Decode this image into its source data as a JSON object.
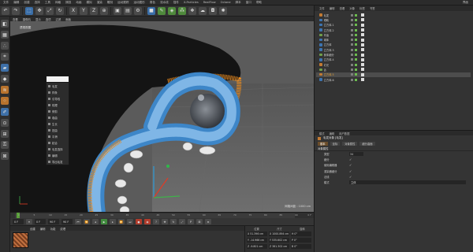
{
  "menubar": {
    "items": [
      "文件",
      "编辑",
      "创建",
      "选择",
      "工具",
      "网格",
      "捕捉",
      "动画",
      "模拟",
      "渲染",
      "雕刻",
      "运动跟踪",
      "运动图形",
      "角色",
      "流水线",
      "插件",
      "X-Particles",
      "RealFlow",
      "Octane",
      "脚本",
      "窗口",
      "帮助"
    ],
    "right_label": "界面"
  },
  "viewport": {
    "menu": [
      "查看",
      "摄像机",
      "显示",
      "选项",
      "过滤",
      "面板"
    ],
    "label": "透视视图",
    "footer": "网格间距 : 1000 cm"
  },
  "context_menu": {
    "items": [
      "毛发",
      "样条",
      "引导线",
      "梳理",
      "修剪",
      "卷曲",
      "生长",
      "扭曲",
      "平滑",
      "粘合",
      "毛发选择",
      "编辑",
      "导出毛发"
    ]
  },
  "timeline": {
    "ticks": [
      "0",
      "5",
      "10",
      "15",
      "20",
      "25",
      "30",
      "35",
      "40",
      "45",
      "50",
      "55",
      "60",
      "65",
      "70",
      "75",
      "80",
      "85",
      "90"
    ],
    "end_label": "0 F"
  },
  "playbar": {
    "start": "0 F",
    "current": "0 F",
    "end": "90 F",
    "end2": "90 F"
  },
  "material_panel": {
    "tabs": [
      "创建",
      "编辑",
      "功能",
      "纹理"
    ]
  },
  "coordinates": {
    "headers": [
      "位置",
      "尺寸",
      "旋转"
    ],
    "rows": [
      [
        "X  51.396 cm",
        "X  1000.894 cm",
        "H  0°"
      ],
      [
        "Y  -14.966 cm",
        "Y  535.602 cm",
        "P  0°"
      ],
      [
        "Z  -9.801 cm",
        "Z  381.302 cm",
        "B  0°"
      ]
    ]
  },
  "object_manager": {
    "menu": [
      "文件",
      "编辑",
      "查看",
      "对象",
      "标签",
      "书签"
    ],
    "rows": [
      {
        "name": "毛发",
        "icon": "orange",
        "highlight": false,
        "selected": false
      },
      {
        "name": "眼睛",
        "icon": "blue",
        "highlight": false,
        "selected": false
      },
      {
        "name": "立方体.1",
        "icon": "blue",
        "highlight": false,
        "selected": false
      },
      {
        "name": "立方体.2",
        "icon": "blue",
        "highlight": false,
        "selected": false
      },
      {
        "name": "牙齿",
        "icon": "green",
        "highlight": false,
        "selected": false
      },
      {
        "name": "球体",
        "icon": "blue",
        "highlight": false,
        "selected": false
      },
      {
        "name": "立方体",
        "icon": "blue",
        "highlight": false,
        "selected": false
      },
      {
        "name": "立方体.3",
        "icon": "blue",
        "highlight": false,
        "selected": false
      },
      {
        "name": "身体细分",
        "icon": "green",
        "highlight": false,
        "selected": false
      },
      {
        "name": "立方体.4",
        "icon": "blue",
        "highlight": false,
        "selected": false
      },
      {
        "name": "灯光",
        "icon": "orange",
        "highlight": false,
        "selected": false
      },
      {
        "name": "舌",
        "icon": "green",
        "highlight": false,
        "selected": false
      },
      {
        "name": "立方体.5",
        "icon": "orange",
        "highlight": true,
        "selected": true
      },
      {
        "name": "立方体.6",
        "icon": "blue",
        "highlight": false,
        "selected": false
      }
    ]
  },
  "attribute_manager": {
    "menu": [
      "模式",
      "编辑",
      "用户数据"
    ],
    "title": "毛发对象 [毛发]",
    "tabs": [
      "基本",
      "坐标",
      "对象属性",
      "细分曲面"
    ],
    "section": "对象属性",
    "fields": [
      {
        "label": "类型",
        "value": "34",
        "kind": "value"
      },
      {
        "label": "细分",
        "value": "✓",
        "kind": "check"
      },
      {
        "label": "使用编辑器",
        "value": "✓",
        "kind": "check"
      },
      {
        "label": "渲染器细分",
        "value": "✓",
        "kind": "check"
      },
      {
        "label": "法线",
        "value": "✓",
        "kind": "check"
      }
    ],
    "mode_label": "模式",
    "mode_value": "立体"
  },
  "colors": {
    "accent_orange": "#e6a43a",
    "hair_blue": "#3d86c8",
    "hair_orange": "#e88a1f",
    "play_green": "#5aa03a"
  }
}
